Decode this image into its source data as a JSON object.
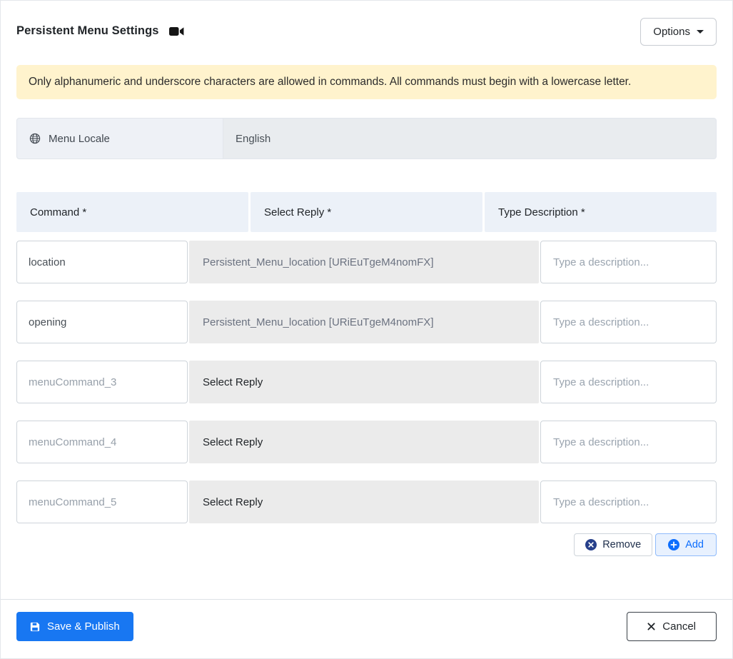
{
  "header": {
    "title": "Persistent Menu Settings",
    "title_icon": "video-camera-icon",
    "options_label": "Options"
  },
  "alert": {
    "text": "Only alphanumeric and underscore characters are allowed in commands. All commands must begin with a lowercase letter."
  },
  "locale": {
    "icon": "globe-icon",
    "label": "Menu Locale",
    "value": "English"
  },
  "table": {
    "headers": [
      "Command *",
      "Select Reply *",
      "Type Description *"
    ],
    "rows": [
      {
        "command_value": "location",
        "reply": "Persistent_Menu_location [URiEuTgeM4nomFX]",
        "description_placeholder": "Type a description..."
      },
      {
        "command_value": "opening",
        "reply": "Persistent_Menu_location [URiEuTgeM4nomFX]",
        "description_placeholder": "Type a description..."
      },
      {
        "command_placeholder": "menuCommand_3",
        "reply": "Select Reply",
        "description_placeholder": "Type a description..."
      },
      {
        "command_placeholder": "menuCommand_4",
        "reply": "Select Reply",
        "description_placeholder": "Type a description..."
      },
      {
        "command_placeholder": "menuCommand_5",
        "reply": "Select Reply",
        "description_placeholder": "Type a description..."
      }
    ]
  },
  "actions": {
    "remove_label": "Remove",
    "remove_icon": "x-circle-icon",
    "add_label": "Add",
    "add_icon": "plus-circle-icon"
  },
  "footer": {
    "save_label": "Save & Publish",
    "save_icon": "save-floppy-icon",
    "cancel_label": "Cancel",
    "cancel_icon": "x-icon"
  },
  "colors": {
    "primary_button": "#1877f2",
    "accent_blue": "#0d6efd",
    "alert_background": "#fff3cd",
    "header_cell_background": "#ecf1f8",
    "field_gray": "#ebebeb"
  }
}
